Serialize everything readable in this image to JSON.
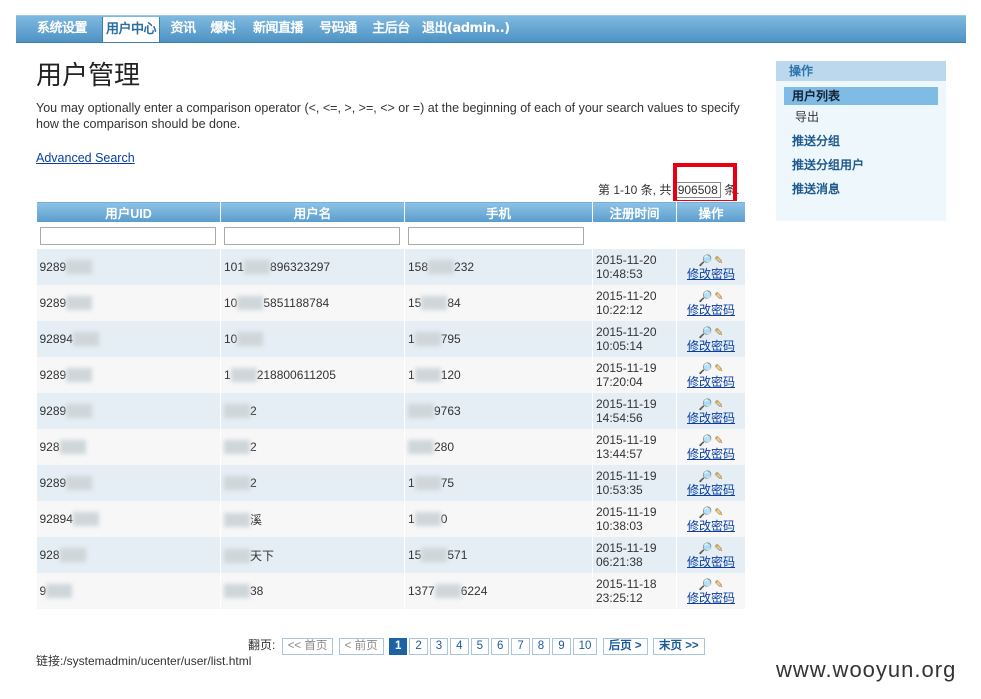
{
  "nav": [
    "系统设置",
    "用户中心",
    "资讯",
    "爆料",
    "新闻直播",
    "号码通",
    "主后台",
    "退出(admin..)"
  ],
  "title": "用户管理",
  "hint": "You may optionally enter a comparison operator (<, <=, >, >=, <> or =) at the beginning of each of your search values to specify how the comparison should be done.",
  "advanced_search": "Advanced Search",
  "summary": {
    "prefix": "第 1-10 条, 共",
    "total": "906508",
    "suffix": "条."
  },
  "table": {
    "headers": [
      "用户UID",
      "用户名",
      "手机",
      "注册时间",
      "操作"
    ],
    "edit_label": "修改密码",
    "rows": [
      {
        "uid": "9289",
        "name": "101",
        "name2": "896323297",
        "phone": "158",
        "phone2": "232",
        "date": "2015-11-20",
        "time": "10:48:53"
      },
      {
        "uid": "9289",
        "name": "10",
        "name2": "5851188784",
        "phone": "15",
        "phone2": "84",
        "date": "2015-11-20",
        "time": "10:22:12"
      },
      {
        "uid": "92894",
        "name": "10",
        "name2": "",
        "phone": "1",
        "phone2": "795",
        "date": "2015-11-20",
        "time": "10:05:14"
      },
      {
        "uid": "9289",
        "name": "1",
        "name2": "218800611205",
        "phone": "1",
        "phone2": "120",
        "date": "2015-11-19",
        "time": "17:20:04"
      },
      {
        "uid": "9289",
        "name": "",
        "name2": "2",
        "phone": "",
        "phone2": "9763",
        "date": "2015-11-19",
        "time": "14:54:56"
      },
      {
        "uid": "928",
        "name": "",
        "name2": "2",
        "phone": "",
        "phone2": "280",
        "date": "2015-11-19",
        "time": "13:44:57"
      },
      {
        "uid": "9289",
        "name": "",
        "name2": "2",
        "phone": "1",
        "phone2": "75",
        "date": "2015-11-19",
        "time": "10:53:35"
      },
      {
        "uid": "92894",
        "name": "",
        "name2": "溪",
        "phone": "1",
        "phone2": "0",
        "date": "2015-11-19",
        "time": "10:38:03"
      },
      {
        "uid": "928",
        "name": "",
        "name2": "天下",
        "phone": "15",
        "phone2": "571",
        "date": "2015-11-19",
        "time": "06:21:38"
      },
      {
        "uid": "9",
        "name2": "38",
        "name": "",
        "phone": "1377",
        "phone2": "6224",
        "date": "2015-11-18",
        "time": "23:25:12"
      }
    ]
  },
  "pager": {
    "label": "翻页:",
    "first": "<< 首页",
    "prev": "< 前页",
    "pages": [
      "1",
      "2",
      "3",
      "4",
      "5",
      "6",
      "7",
      "8",
      "9",
      "10"
    ],
    "next": "后页 >",
    "last": "末页 >>"
  },
  "link": "链接:/systemadmin/ucenter/user/list.html",
  "sidebar": {
    "head": "操作",
    "items": [
      "用户列表",
      "导出",
      "推送分组",
      "推送分组用户",
      "推送消息"
    ]
  },
  "watermark": "www.wooyun.org"
}
